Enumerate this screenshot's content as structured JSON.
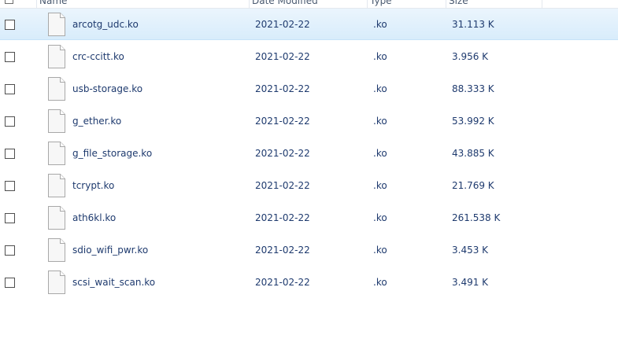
{
  "header": {
    "name": "Name",
    "date": "Date Modified",
    "type": "Type",
    "size": "Size"
  },
  "files": [
    {
      "name": "arcotg_udc.ko",
      "date": "2021-02-22",
      "type": ".ko",
      "size": "31.113 K",
      "selected": true
    },
    {
      "name": "crc-ccitt.ko",
      "date": "2021-02-22",
      "type": ".ko",
      "size": "3.956 K"
    },
    {
      "name": "usb-storage.ko",
      "date": "2021-02-22",
      "type": ".ko",
      "size": "88.333 K"
    },
    {
      "name": "g_ether.ko",
      "date": "2021-02-22",
      "type": ".ko",
      "size": "53.992 K"
    },
    {
      "name": "g_file_storage.ko",
      "date": "2021-02-22",
      "type": ".ko",
      "size": "43.885 K"
    },
    {
      "name": "tcrypt.ko",
      "date": "2021-02-22",
      "type": ".ko",
      "size": "21.769 K"
    },
    {
      "name": "ath6kl.ko",
      "date": "2021-02-22",
      "type": ".ko",
      "size": "261.538 K"
    },
    {
      "name": "sdio_wifi_pwr.ko",
      "date": "2021-02-22",
      "type": ".ko",
      "size": "3.453 K"
    },
    {
      "name": "scsi_wait_scan.ko",
      "date": "2021-02-22",
      "type": ".ko",
      "size": "3.491 K"
    }
  ]
}
